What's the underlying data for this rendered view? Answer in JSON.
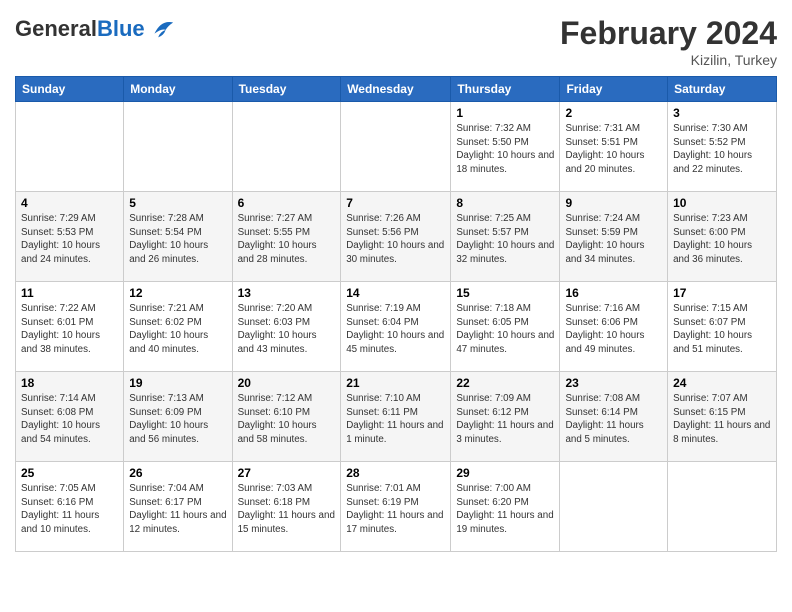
{
  "logo": {
    "general": "General",
    "blue": "Blue"
  },
  "title": "February 2024",
  "location": "Kizilin, Turkey",
  "days_of_week": [
    "Sunday",
    "Monday",
    "Tuesday",
    "Wednesday",
    "Thursday",
    "Friday",
    "Saturday"
  ],
  "weeks": [
    [
      {
        "day": "",
        "sunrise": "",
        "sunset": "",
        "daylight": ""
      },
      {
        "day": "",
        "sunrise": "",
        "sunset": "",
        "daylight": ""
      },
      {
        "day": "",
        "sunrise": "",
        "sunset": "",
        "daylight": ""
      },
      {
        "day": "",
        "sunrise": "",
        "sunset": "",
        "daylight": ""
      },
      {
        "day": "1",
        "sunrise": "Sunrise: 7:32 AM",
        "sunset": "Sunset: 5:50 PM",
        "daylight": "Daylight: 10 hours and 18 minutes."
      },
      {
        "day": "2",
        "sunrise": "Sunrise: 7:31 AM",
        "sunset": "Sunset: 5:51 PM",
        "daylight": "Daylight: 10 hours and 20 minutes."
      },
      {
        "day": "3",
        "sunrise": "Sunrise: 7:30 AM",
        "sunset": "Sunset: 5:52 PM",
        "daylight": "Daylight: 10 hours and 22 minutes."
      }
    ],
    [
      {
        "day": "4",
        "sunrise": "Sunrise: 7:29 AM",
        "sunset": "Sunset: 5:53 PM",
        "daylight": "Daylight: 10 hours and 24 minutes."
      },
      {
        "day": "5",
        "sunrise": "Sunrise: 7:28 AM",
        "sunset": "Sunset: 5:54 PM",
        "daylight": "Daylight: 10 hours and 26 minutes."
      },
      {
        "day": "6",
        "sunrise": "Sunrise: 7:27 AM",
        "sunset": "Sunset: 5:55 PM",
        "daylight": "Daylight: 10 hours and 28 minutes."
      },
      {
        "day": "7",
        "sunrise": "Sunrise: 7:26 AM",
        "sunset": "Sunset: 5:56 PM",
        "daylight": "Daylight: 10 hours and 30 minutes."
      },
      {
        "day": "8",
        "sunrise": "Sunrise: 7:25 AM",
        "sunset": "Sunset: 5:57 PM",
        "daylight": "Daylight: 10 hours and 32 minutes."
      },
      {
        "day": "9",
        "sunrise": "Sunrise: 7:24 AM",
        "sunset": "Sunset: 5:59 PM",
        "daylight": "Daylight: 10 hours and 34 minutes."
      },
      {
        "day": "10",
        "sunrise": "Sunrise: 7:23 AM",
        "sunset": "Sunset: 6:00 PM",
        "daylight": "Daylight: 10 hours and 36 minutes."
      }
    ],
    [
      {
        "day": "11",
        "sunrise": "Sunrise: 7:22 AM",
        "sunset": "Sunset: 6:01 PM",
        "daylight": "Daylight: 10 hours and 38 minutes."
      },
      {
        "day": "12",
        "sunrise": "Sunrise: 7:21 AM",
        "sunset": "Sunset: 6:02 PM",
        "daylight": "Daylight: 10 hours and 40 minutes."
      },
      {
        "day": "13",
        "sunrise": "Sunrise: 7:20 AM",
        "sunset": "Sunset: 6:03 PM",
        "daylight": "Daylight: 10 hours and 43 minutes."
      },
      {
        "day": "14",
        "sunrise": "Sunrise: 7:19 AM",
        "sunset": "Sunset: 6:04 PM",
        "daylight": "Daylight: 10 hours and 45 minutes."
      },
      {
        "day": "15",
        "sunrise": "Sunrise: 7:18 AM",
        "sunset": "Sunset: 6:05 PM",
        "daylight": "Daylight: 10 hours and 47 minutes."
      },
      {
        "day": "16",
        "sunrise": "Sunrise: 7:16 AM",
        "sunset": "Sunset: 6:06 PM",
        "daylight": "Daylight: 10 hours and 49 minutes."
      },
      {
        "day": "17",
        "sunrise": "Sunrise: 7:15 AM",
        "sunset": "Sunset: 6:07 PM",
        "daylight": "Daylight: 10 hours and 51 minutes."
      }
    ],
    [
      {
        "day": "18",
        "sunrise": "Sunrise: 7:14 AM",
        "sunset": "Sunset: 6:08 PM",
        "daylight": "Daylight: 10 hours and 54 minutes."
      },
      {
        "day": "19",
        "sunrise": "Sunrise: 7:13 AM",
        "sunset": "Sunset: 6:09 PM",
        "daylight": "Daylight: 10 hours and 56 minutes."
      },
      {
        "day": "20",
        "sunrise": "Sunrise: 7:12 AM",
        "sunset": "Sunset: 6:10 PM",
        "daylight": "Daylight: 10 hours and 58 minutes."
      },
      {
        "day": "21",
        "sunrise": "Sunrise: 7:10 AM",
        "sunset": "Sunset: 6:11 PM",
        "daylight": "Daylight: 11 hours and 1 minute."
      },
      {
        "day": "22",
        "sunrise": "Sunrise: 7:09 AM",
        "sunset": "Sunset: 6:12 PM",
        "daylight": "Daylight: 11 hours and 3 minutes."
      },
      {
        "day": "23",
        "sunrise": "Sunrise: 7:08 AM",
        "sunset": "Sunset: 6:14 PM",
        "daylight": "Daylight: 11 hours and 5 minutes."
      },
      {
        "day": "24",
        "sunrise": "Sunrise: 7:07 AM",
        "sunset": "Sunset: 6:15 PM",
        "daylight": "Daylight: 11 hours and 8 minutes."
      }
    ],
    [
      {
        "day": "25",
        "sunrise": "Sunrise: 7:05 AM",
        "sunset": "Sunset: 6:16 PM",
        "daylight": "Daylight: 11 hours and 10 minutes."
      },
      {
        "day": "26",
        "sunrise": "Sunrise: 7:04 AM",
        "sunset": "Sunset: 6:17 PM",
        "daylight": "Daylight: 11 hours and 12 minutes."
      },
      {
        "day": "27",
        "sunrise": "Sunrise: 7:03 AM",
        "sunset": "Sunset: 6:18 PM",
        "daylight": "Daylight: 11 hours and 15 minutes."
      },
      {
        "day": "28",
        "sunrise": "Sunrise: 7:01 AM",
        "sunset": "Sunset: 6:19 PM",
        "daylight": "Daylight: 11 hours and 17 minutes."
      },
      {
        "day": "29",
        "sunrise": "Sunrise: 7:00 AM",
        "sunset": "Sunset: 6:20 PM",
        "daylight": "Daylight: 11 hours and 19 minutes."
      },
      {
        "day": "",
        "sunrise": "",
        "sunset": "",
        "daylight": ""
      },
      {
        "day": "",
        "sunrise": "",
        "sunset": "",
        "daylight": ""
      }
    ]
  ]
}
